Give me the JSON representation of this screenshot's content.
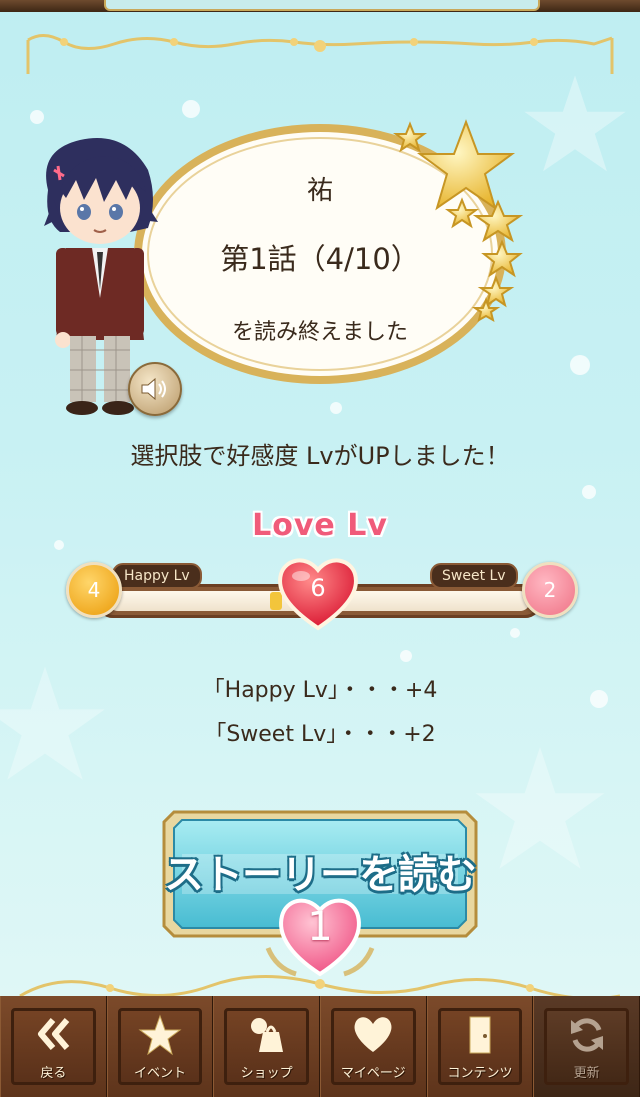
{
  "result": {
    "character_name": "祐",
    "chapter": "第1話（4/10）",
    "finished_text": "を読み終えました",
    "up_message": "選択肢で好感度 LvがUPしました！"
  },
  "love": {
    "title": "Love Lv",
    "level": "6",
    "happy_label": "Happy Lv",
    "sweet_label": "Sweet Lv",
    "happy_value": "4",
    "sweet_value": "2",
    "progress_fraction": 0.4
  },
  "bonus": {
    "line1": "「Happy Lv」・・・+4",
    "line2": "「Sweet Lv」・・・+2"
  },
  "story_button": {
    "label": "ストーリーを読む",
    "count": "1"
  },
  "tabs": [
    {
      "label": "戻る",
      "icon": "double-chevron-left-icon"
    },
    {
      "label": "イベント",
      "icon": "star-icon"
    },
    {
      "label": "ショップ",
      "icon": "shop-bag-icon"
    },
    {
      "label": "マイページ",
      "icon": "heart-icon"
    },
    {
      "label": "コンテンツ",
      "icon": "door-icon"
    },
    {
      "label": "更新",
      "icon": "refresh-icon"
    }
  ],
  "colors": {
    "accent_pink": "#f05b7a",
    "brown": "#5e341b",
    "gold": "#d9b25a",
    "sky": "#c8f1f3"
  }
}
